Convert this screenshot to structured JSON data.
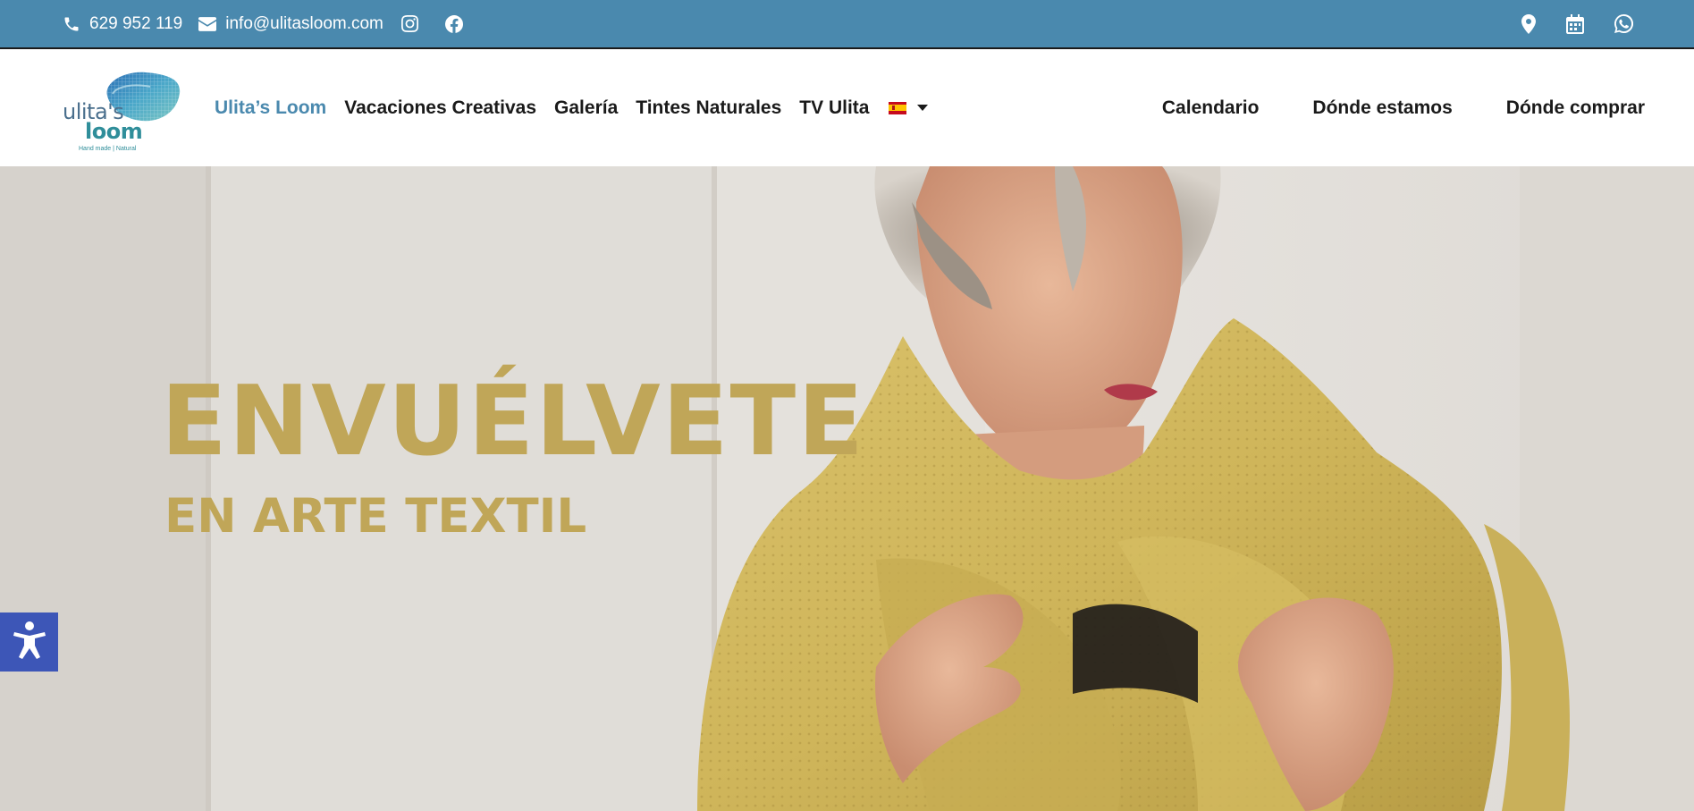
{
  "topbar": {
    "phone": "629 952 119",
    "email": "info@ulitasloom.com",
    "icons": [
      "phone-icon",
      "mail-icon",
      "instagram-icon",
      "facebook-icon",
      "map-pin-icon",
      "calendar-icon",
      "whatsapp-icon"
    ],
    "background_color": "#4a89ae"
  },
  "logo": {
    "line1": "ulita's",
    "line2": "loom",
    "tagline": "Hand made | Natural"
  },
  "nav": {
    "items": [
      {
        "label": "Ulita’s Loom",
        "active": true
      },
      {
        "label": "Vacaciones Creativas"
      },
      {
        "label": "Galería"
      },
      {
        "label": "Tintes Naturales"
      },
      {
        "label": "TV Ulita"
      }
    ],
    "language_flag": "es-flag-icon"
  },
  "nav_right": {
    "items": [
      {
        "label": "Calendario"
      },
      {
        "label": "Dónde estamos"
      },
      {
        "label": "Dónde comprar"
      }
    ]
  },
  "hero": {
    "title": "ENVUÉLVETE",
    "subtitle": "EN ARTE TEXTIL",
    "text_color": "#c0a658"
  },
  "accessibility": {
    "icon": "accessibility-icon",
    "color": "#3d56b7"
  }
}
